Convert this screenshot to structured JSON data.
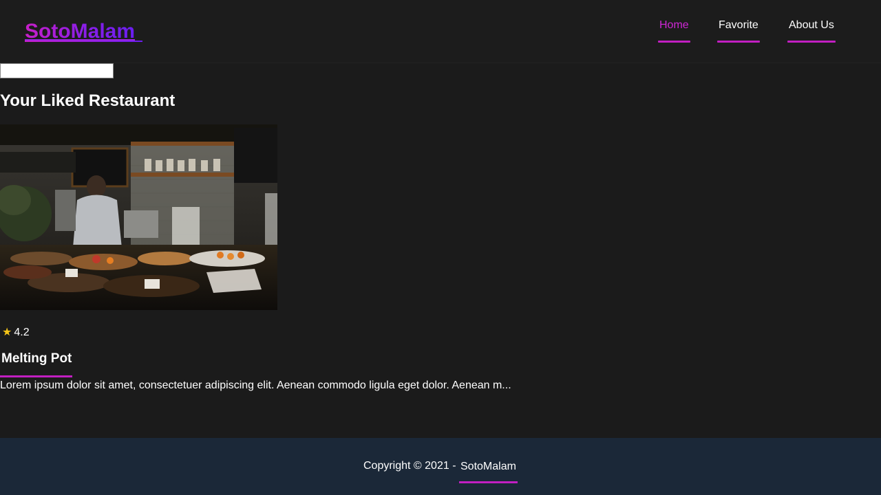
{
  "header": {
    "logo": "SotoMalam",
    "nav": [
      {
        "label": "Home",
        "active": true
      },
      {
        "label": "Favorite",
        "active": false
      },
      {
        "label": "About Us",
        "active": false
      }
    ]
  },
  "search": {
    "value": "",
    "placeholder": ""
  },
  "main": {
    "title": "Your Liked Restaurant",
    "restaurants": [
      {
        "rating": "4.2",
        "name": "Melting Pot",
        "description": "Lorem ipsum dolor sit amet, consectetuer adipiscing elit. Aenean commodo ligula eget dolor. Aenean m..."
      }
    ]
  },
  "footer": {
    "copyright": "Copyright © 2021 -",
    "brand": "SotoMalam"
  },
  "colors": {
    "background": "#1b1b1b",
    "accent": "#c21fc2",
    "footer_bg": "#1b2838",
    "star": "#f5c518"
  },
  "icons": {
    "rating": "star-icon"
  }
}
